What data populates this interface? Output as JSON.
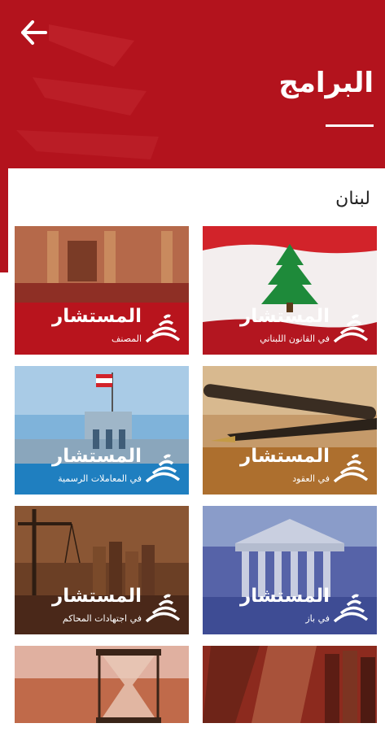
{
  "header": {
    "title": "البرامج",
    "back_icon": "arrow-left-icon",
    "background": "#b3131d"
  },
  "section": {
    "label": "لبنان"
  },
  "programs": [
    {
      "name": "المستشار",
      "subtitle": "في القانون اللبناني",
      "theme": "lebanese-flag"
    },
    {
      "name": "المستشار",
      "subtitle": "المصنف",
      "theme": "courtroom"
    },
    {
      "name": "المستشار",
      "subtitle": "في العقود",
      "theme": "pen-paper"
    },
    {
      "name": "المستشار",
      "subtitle": "في المعاملات الرسمية",
      "theme": "government-palace"
    },
    {
      "name": "المستشار",
      "subtitle": "في باز",
      "theme": "courthouse-columns"
    },
    {
      "name": "المستشار",
      "subtitle": "في اجتهادات المحاكم",
      "theme": "scales-books"
    },
    {
      "name": "",
      "subtitle": "",
      "theme": "books-scales"
    },
    {
      "name": "",
      "subtitle": "",
      "theme": "hourglass"
    }
  ]
}
